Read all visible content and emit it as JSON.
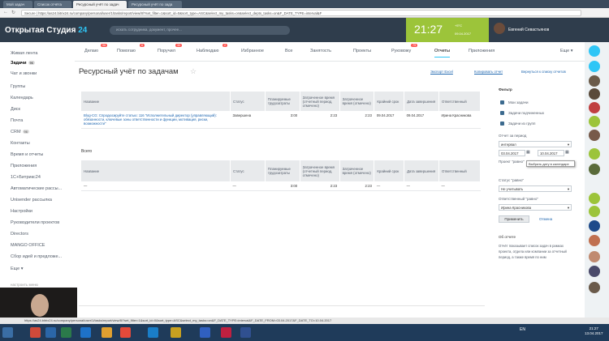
{
  "browser": {
    "tabs": [
      "Мой задач",
      "Список отчёта",
      "Ресурсный учёт по задач",
      "Ресурсный учёт по зада"
    ],
    "url": "Secure | https://as24.bitrix24.ru/company/personal/user/1/tasks/report/view/8/?set_filter=1&sort_id=0&sort_type=ASC&select_my_tasks=on&select_depts_tasks=on&F_DATE_TYPE=interval&F"
  },
  "header": {
    "logo_text": "Открытая Студия",
    "logo_num": "24",
    "search_placeholder": "искать сотрудника, документ, прочее...",
    "clock": "21:27",
    "weather": "+5°C",
    "date": "09.04.2017",
    "user_name": "Евгений Севастьянов"
  },
  "sidebar": {
    "items": [
      {
        "label": "Живая лента",
        "count": ""
      },
      {
        "label": "Задачи",
        "count": "96"
      },
      {
        "label": "Чат и звонки",
        "count": ""
      },
      {
        "label": "Группы",
        "count": ""
      },
      {
        "label": "Календарь",
        "count": ""
      },
      {
        "label": "Диск",
        "count": ""
      },
      {
        "label": "Почта",
        "count": ""
      },
      {
        "label": "CRM",
        "count": "96"
      },
      {
        "label": "Контакты",
        "count": ""
      },
      {
        "label": "Время и отчеты",
        "count": ""
      },
      {
        "label": "Приложения",
        "count": ""
      },
      {
        "label": "1С+Битрикс24",
        "count": ""
      },
      {
        "label": "Автоматические рассы...",
        "count": ""
      },
      {
        "label": "Unisender рассылка",
        "count": ""
      },
      {
        "label": "Настройки",
        "count": ""
      },
      {
        "label": "Руководители проектов",
        "count": ""
      },
      {
        "label": "Directors",
        "count": ""
      },
      {
        "label": "MANGO OFFICE",
        "count": ""
      },
      {
        "label": "Сбор идей и предложе...",
        "count": ""
      },
      {
        "label": "Еще",
        "count": ""
      }
    ],
    "setup_menu": "настроить меню"
  },
  "topnav": [
    {
      "label": "Делаю",
      "badge": "96"
    },
    {
      "label": "Помогаю",
      "badge": "6"
    },
    {
      "label": "Поручил",
      "badge": "30"
    },
    {
      "label": "Наблюдаю",
      "badge": "2"
    },
    {
      "label": "Избранное",
      "badge": ""
    },
    {
      "label": "Все",
      "badge": ""
    },
    {
      "label": "Занятость",
      "badge": ""
    },
    {
      "label": "Проекты",
      "badge": ""
    },
    {
      "label": "Руковожу",
      "badge": "79"
    },
    {
      "label": "Отчеты",
      "badge": ""
    },
    {
      "label": "Приложения",
      "badge": ""
    },
    {
      "label": "Еще",
      "badge": ""
    }
  ],
  "page": {
    "title": "Ресурсный учёт по задачам",
    "links": [
      "Экспорт Excel",
      "Копировать отчет",
      "Вернуться к списку отчетов"
    ]
  },
  "table1": {
    "headers": [
      "Название",
      "Статус",
      "Планируемые трудозатраты",
      "Затраченное время (отчетный период, отмечено)",
      "Затраченное время (отмечено)",
      "Крайний срок",
      "Дата завершения",
      "Ответственный"
    ],
    "rows": [
      [
        "Blog-СG: Спродюсируйте статью: 116 \"Исполнительный директор (управляющий): обязанности, ключевые зоны ответственности и функции, мотивация, риски, возможности\"",
        "Завершена",
        "3:00",
        "2:23",
        "2:23",
        "09.04.2017",
        "09.04.2017",
        "Ирина Красникова"
      ]
    ]
  },
  "total_label": "Всего",
  "table2": {
    "headers": [
      "Название",
      "Статус",
      "Планируемые трудозатраты",
      "Затраченное время (отчетный период, отмечено)",
      "Затраченное время (отмечено)",
      "Крайний срок",
      "Дата завершения",
      "Ответственный"
    ],
    "rows": [
      [
        "—",
        "—",
        "3:00",
        "2:23",
        "2:23",
        "—",
        "—",
        "—"
      ]
    ]
  },
  "filter": {
    "title": "Фильтр",
    "checks": [
      "Мои задачи",
      "Задачи подчиненных",
      "Задачи из групп"
    ],
    "period_label": "Отчет за период",
    "period_value": "интервал",
    "date_from": "03.04.2017",
    "date_to": "10.04.2017",
    "project_label": "Проект \"равно\"",
    "tooltip": "Выбрать дату в календаре",
    "status_label": "Статус \"равно\"",
    "status_value": "Не учитывать",
    "responsible_label": "Ответственный \"равно\"",
    "responsible_value": "Ирина Красникова",
    "apply": "Применить",
    "cancel": "Отмена",
    "about_title": "Об отчете",
    "about_text": "Отчёт показывает список задач в рамках проекта, отдела или компании за отчетный период, а также время по ним"
  },
  "statusbar": "https://as24.bitrix24.ru/company/personal/user/1/tasks/report/view/8/?set_filter=1&sort_id=0&sort_type=ASC&select_my_tasks=on&F_DATE_TYPE=interval&F_DATE_FROM=03.04.2017&F_DATE_TO=10.04.2017",
  "taskbar": {
    "lang": "EN",
    "time": "21:27",
    "date": "13.04.2017"
  }
}
